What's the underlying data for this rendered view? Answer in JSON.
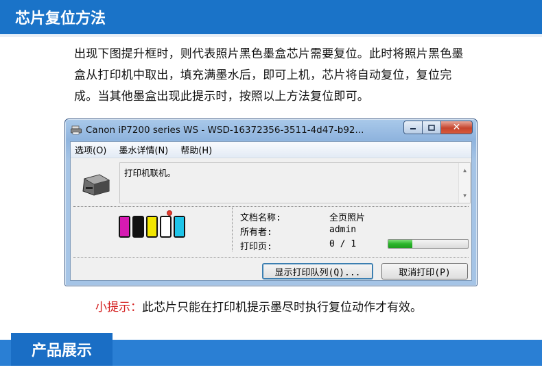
{
  "header": {
    "title": "芯片复位方法"
  },
  "description": "出现下图提升框时，则代表照片黑色墨盒芯片需要复位。此时将照片黑色墨盒从打印机中取出，填充满墨水后，即可上机，芯片将自动复位，复位完成。当其他墨盒出现此提示时，按照以上方法复位即可。",
  "window": {
    "title": "Canon iP7200 series WS - WSD-16372356-3511-4d47-b92...",
    "menu": [
      "选项(O)",
      "墨水详情(N)",
      "帮助(H)"
    ],
    "status_text": "打印机联机。",
    "info": {
      "doc_label": "文档名称:",
      "doc_value": "全页照片",
      "owner_label": "所有者:",
      "owner_value": "admin",
      "pages_label": "打印页:",
      "pages_value": "0 / 1"
    },
    "progress": 0.3,
    "buttons": {
      "show_queue": "显示打印队列(Q)...",
      "cancel": "取消打印(P)"
    },
    "ink_colors": [
      "#d61ab2",
      "#111111",
      "#f2e600",
      "#ffffff",
      "#1fc4e8"
    ],
    "ink_fill": [
      1.0,
      1.0,
      1.0,
      0.0,
      1.0
    ]
  },
  "tip": {
    "label": "小提示：",
    "text": "此芯片只能在打印机提示墨尽时执行复位动作才有效。"
  },
  "footer": {
    "title": "产品展示"
  }
}
